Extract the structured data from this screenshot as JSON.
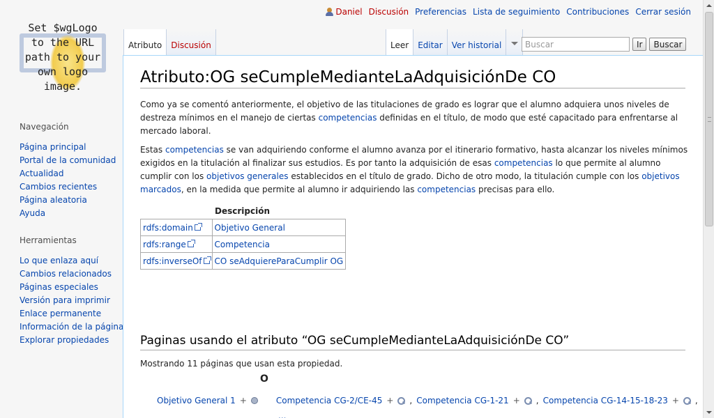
{
  "personal": {
    "user": "Daniel",
    "talk": "Discusión",
    "preferences": "Preferencias",
    "watchlist": "Lista de seguimiento",
    "contributions": "Contribuciones",
    "logout": "Cerrar sesión"
  },
  "logo": {
    "lines": [
      "Set $wgLogo",
      "to the URL",
      "path to your",
      "own logo",
      "image."
    ]
  },
  "sidebar": {
    "navigation": {
      "heading": "Navegación",
      "items": [
        "Página principal",
        "Portal de la comunidad",
        "Actualidad",
        "Cambios recientes",
        "Página aleatoria",
        "Ayuda"
      ]
    },
    "tools": {
      "heading": "Herramientas",
      "items": [
        "Lo que enlaza aquí",
        "Cambios relacionados",
        "Páginas especiales",
        "Versión para imprimir",
        "Enlace permanente",
        "Información de la página",
        "Explorar propiedades"
      ]
    }
  },
  "tabs": {
    "attribute": "Atributo",
    "discussion": "Discusión",
    "read": "Leer",
    "edit": "Editar",
    "history": "Ver historial"
  },
  "search": {
    "placeholder": "Buscar",
    "go": "Ir",
    "search": "Buscar"
  },
  "page": {
    "title": "Atributo:OG seCumpleMedianteLaAdquisiciónDe CO",
    "p1": {
      "t1": "Como ya se comentó anteriormente, el objetivo de las titulaciones de grado es lograr que el alumno adquiera unos niveles de destreza mínimos en el manejo de ciertas ",
      "l1": "competencias",
      "t2": " definidas en el título, de modo que esté capacitado para enfrentarse al mercado laboral."
    },
    "p2": {
      "t1": "Estas ",
      "l1": "competencias",
      "t2": " se van adquiriendo conforme el alumno avanza por el itinerario formativo, hasta alcanzar los niveles mínimos exigidos en la titulación al finalizar sus estudios. Es por tanto la adquisición de esas ",
      "l2": "competencias",
      "t3": " lo que permite al alumno cumplir con los ",
      "l3": "objetivos generales",
      "t4": " establecidos en el título de grado. Dicho de otro modo, la titulación cumple con los ",
      "l4": "objetivos marcados",
      "t5": ", en la medida que permite al alumno ir adquiriendo las ",
      "l5": "competencias",
      "t6": " precisas para ello."
    },
    "desc_caption": "Descripción",
    "props": [
      {
        "key": "rdfs:domain",
        "value": "Objetivo General"
      },
      {
        "key": "rdfs:range",
        "value": "Competencia"
      },
      {
        "key": "rdfs:inverseOf",
        "value": "CO seAdquiereParaCumplir OG"
      }
    ],
    "using_heading": "Paginas usando el atributo “OG seCumpleMedianteLaAdquisiciónDe CO”",
    "showing": {
      "t1": "Mostrando ",
      "count": "11",
      "t2": " páginas que usan esta propiedad."
    },
    "letter": "O",
    "row": {
      "subject": "Objetivo General 1",
      "values": [
        "Competencia CG-2/CE-45",
        "Competencia CG-1-21",
        "Competencia CG-14-15-18-23"
      ],
      "more": "..."
    }
  },
  "colors": {
    "link": "#0645ad",
    "new_link": "#ba0000",
    "border": "#a7d7f9"
  }
}
